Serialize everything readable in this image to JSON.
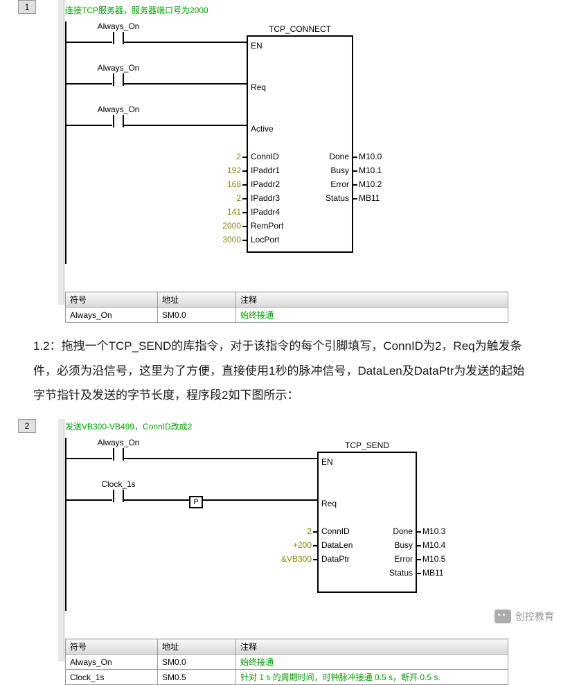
{
  "seg1": {
    "num": "1",
    "title": "连接TCP服务器，服务器端口号为2000",
    "contacts": [
      "Always_On",
      "Always_On",
      "Always_On"
    ],
    "block": {
      "title": "TCP_CONNECT",
      "left_pins": [
        "EN",
        "Req",
        "Active",
        "ConnID",
        "IPaddr1",
        "IPaddr2",
        "IPaddr3",
        "IPaddr4",
        "RemPort",
        "LocPort"
      ],
      "left_vals": [
        "",
        "",
        "",
        "2",
        "192",
        "168",
        "2",
        "141",
        "2000",
        "3000"
      ],
      "right_pins": [
        "",
        "",
        "",
        "Done",
        "Busy",
        "Error",
        "Status",
        "",
        "",
        ""
      ],
      "right_vals": [
        "",
        "",
        "",
        "M10.0",
        "M10.1",
        "M10.2",
        "MB11",
        "",
        "",
        ""
      ]
    },
    "symtable": {
      "headers": [
        "符号",
        "地址",
        "注释"
      ],
      "rows": [
        [
          "Always_On",
          "SM0.0",
          "始终接通"
        ]
      ]
    }
  },
  "bodytext": "1.2：拖拽一个TCP_SEND的库指令，对于该指令的每个引脚填写，ConnID为2，Req为触发条件，必须为沿信号，这里为了方便，直接使用1秒的脉冲信号，DataLen及DataPtr为发送的起始字节指针及发送的字节长度，程序段2如下图所示：",
  "seg2": {
    "num": "2",
    "title": "发送VB300-VB499，ConnID改成2",
    "contacts": [
      "Always_On",
      "Clock_1s"
    ],
    "p_label": "P",
    "block": {
      "title": "TCP_SEND",
      "left_pins": [
        "EN",
        "Req",
        "ConnID",
        "DataLen",
        "DataPtr"
      ],
      "left_vals": [
        "",
        "",
        "2",
        "+200",
        "&VB300"
      ],
      "right_pins": [
        "",
        "",
        "Done",
        "Busy",
        "Error",
        "Status"
      ],
      "right_vals": [
        "",
        "",
        "M10.3",
        "M10.4",
        "M10.5",
        "MB11"
      ]
    },
    "symtable": {
      "headers": [
        "符号",
        "地址",
        "注释"
      ],
      "rows": [
        [
          "Always_On",
          "SM0.0",
          "始终接通"
        ],
        [
          "Clock_1s",
          "SM0.5",
          "针对 1 s 的周期时间，时钟脉冲接通 0.5 s，断开 0.5 s."
        ]
      ]
    }
  },
  "footer": "创控教育"
}
